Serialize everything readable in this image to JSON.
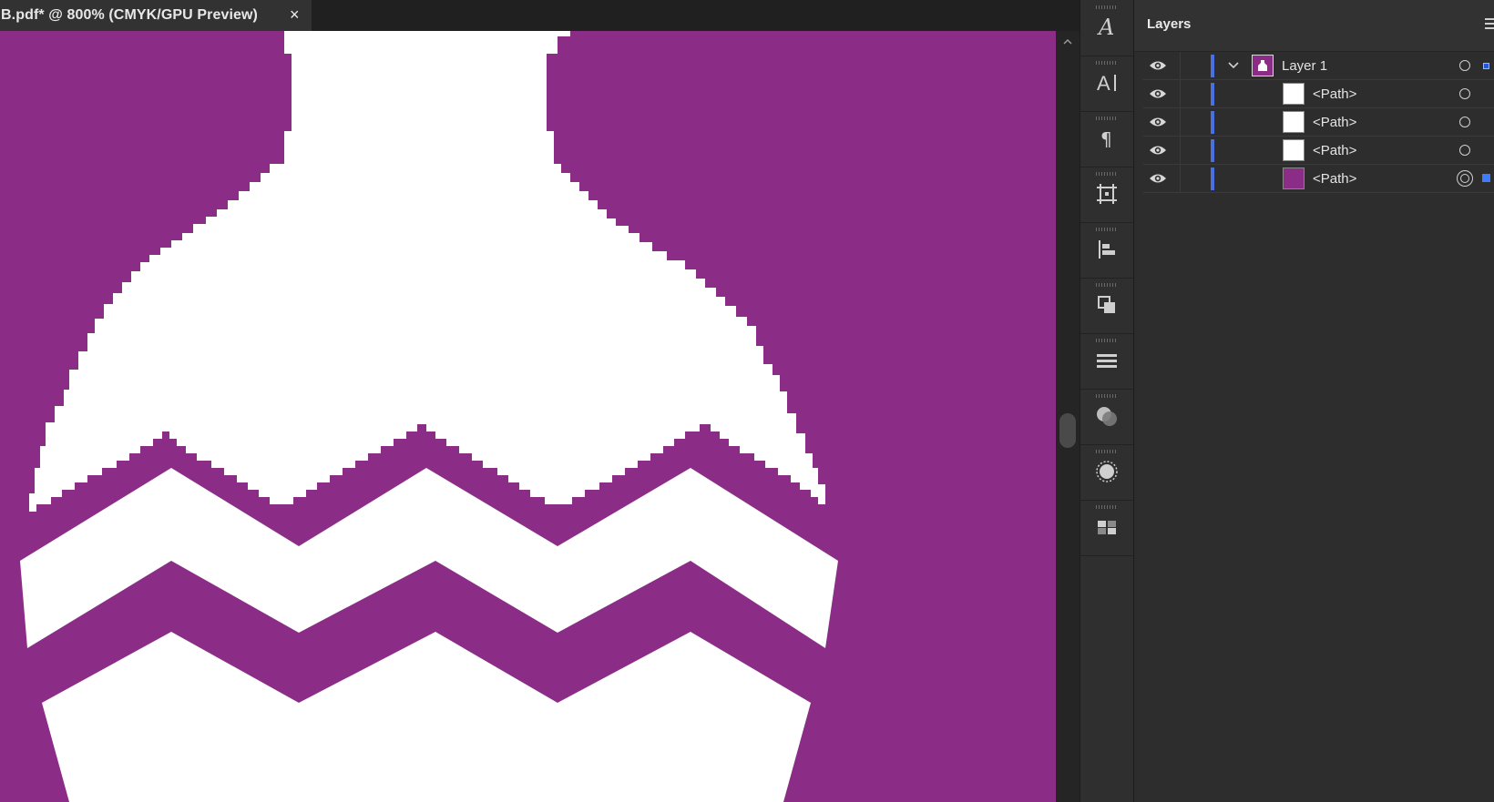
{
  "document": {
    "tab_title": "B.pdf* @ 800% (CMYK/GPU Preview)",
    "close_label": "×"
  },
  "colors": {
    "artwork_purple": "#8b2d86",
    "artwork_white": "#ffffff",
    "layer_color": "#4b6fe0",
    "selection_blue": "#3f7bff"
  },
  "toolstrip": {
    "icons": [
      "character-styles-icon",
      "character-icon",
      "paragraph-icon",
      "artboards-icon",
      "align-icon",
      "pathfinder-icon",
      "stroke-icon",
      "transparency-icon",
      "appearance-icon",
      "swatches-icon"
    ]
  },
  "layers_panel": {
    "title": "Layers",
    "rows": [
      {
        "label": "Layer 1",
        "type": "layer",
        "expanded": true,
        "thumb_color": "#8b2d86",
        "selected_indicator": true
      },
      {
        "label": "<Path>",
        "type": "path",
        "thumb_color": "#ffffff"
      },
      {
        "label": "<Path>",
        "type": "path",
        "thumb_color": "#ffffff"
      },
      {
        "label": "<Path>",
        "type": "path",
        "thumb_color": "#ffffff"
      },
      {
        "label": "<Path>",
        "type": "path",
        "thumb_color": "#8b2d86",
        "selected_indicator": true
      }
    ]
  }
}
